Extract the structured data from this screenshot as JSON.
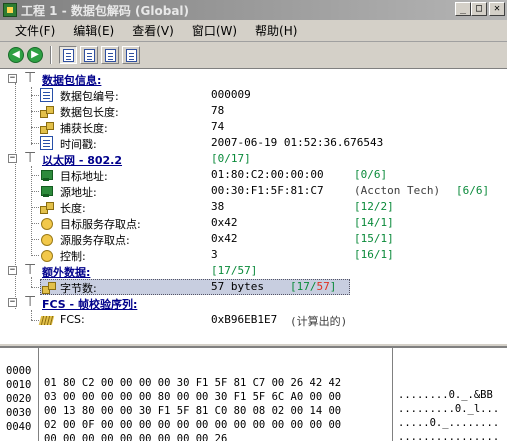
{
  "window": {
    "title": "工程 1 - 数据包解码 (Global)",
    "minimize": "_",
    "maximize": "□",
    "close": "✕"
  },
  "menu": [
    {
      "label": "文件(F)"
    },
    {
      "label": "编辑(E)"
    },
    {
      "label": "查看(V)"
    },
    {
      "label": "窗口(W)"
    },
    {
      "label": "帮助(H)"
    }
  ],
  "toolbar": {
    "back_icon": "back-arrow-icon",
    "forward_icon": "forward-arrow-icon",
    "buttons": [
      "view-tree-button",
      "view-hex-button",
      "view-both-button",
      "view-list-button"
    ]
  },
  "tree": {
    "packet_info": {
      "title": "数据包信息:",
      "fields": [
        {
          "label": "数据包编号:",
          "value": "000009"
        },
        {
          "label": "数据包长度:",
          "value": "78"
        },
        {
          "label": "捕获长度:",
          "value": "74"
        },
        {
          "label": "时间戳:",
          "value": "2007-06-19 01:52:36.676543"
        }
      ]
    },
    "ethernet": {
      "title": "以太网 - 802.2",
      "range": "[0/17]",
      "fields": [
        {
          "label": "目标地址:",
          "value": "01:80:C2:00:00:00",
          "extra": "",
          "range": "[0/6]"
        },
        {
          "label": "源地址:",
          "value": "00:30:F1:5F:81:C7",
          "extra": "(Accton Tech)",
          "range": "[6/6]"
        },
        {
          "label": "长度:",
          "value": "38",
          "extra": "",
          "range": "[12/2]"
        },
        {
          "label": "目标服务存取点:",
          "value": "0x42",
          "extra": "",
          "range": "[14/1]"
        },
        {
          "label": "源服务存取点:",
          "value": "0x42",
          "extra": "",
          "range": "[15/1]"
        },
        {
          "label": "控制:",
          "value": "3",
          "extra": "",
          "range": "[16/1]"
        }
      ]
    },
    "extra_data": {
      "title": "额外数据:",
      "range": "[17/57]",
      "fields": [
        {
          "label": "字节数:",
          "value": "57 bytes",
          "range_prefix": "[17/",
          "range_hi": "57",
          "range_suffix": "]"
        }
      ]
    },
    "fcs": {
      "title": "FCS - 帧校验序列:",
      "fields": [
        {
          "label": "FCS:",
          "value": "0xB96EB1E7",
          "extra": "(计算出的)"
        }
      ]
    }
  },
  "hex": {
    "rows": [
      {
        "offset": "0000",
        "bytes": "01 80 C2 00 00 00 00 30 F1 5F 81 C7 00 26 42 42",
        "ascii": "........0._.&BB"
      },
      {
        "offset": "0010",
        "bytes": "03 00 00 00 00 00 80 00 00 30 F1 5F 6C A0 00 00",
        "ascii": ".........0._l..."
      },
      {
        "offset": "0020",
        "bytes": "00 13 80 00 00 30 F1 5F 81 C0 80 08 02 00 14 00",
        "ascii": ".....0._........"
      },
      {
        "offset": "0030",
        "bytes": "02 00 0F 00 00 00 00 00 00 00 00 00 00 00 00 00",
        "ascii": "................"
      },
      {
        "offset": "0040",
        "bytes": "00 00 00 00 00 00 00 00 00 26",
        "ascii": "..........&"
      }
    ]
  }
}
